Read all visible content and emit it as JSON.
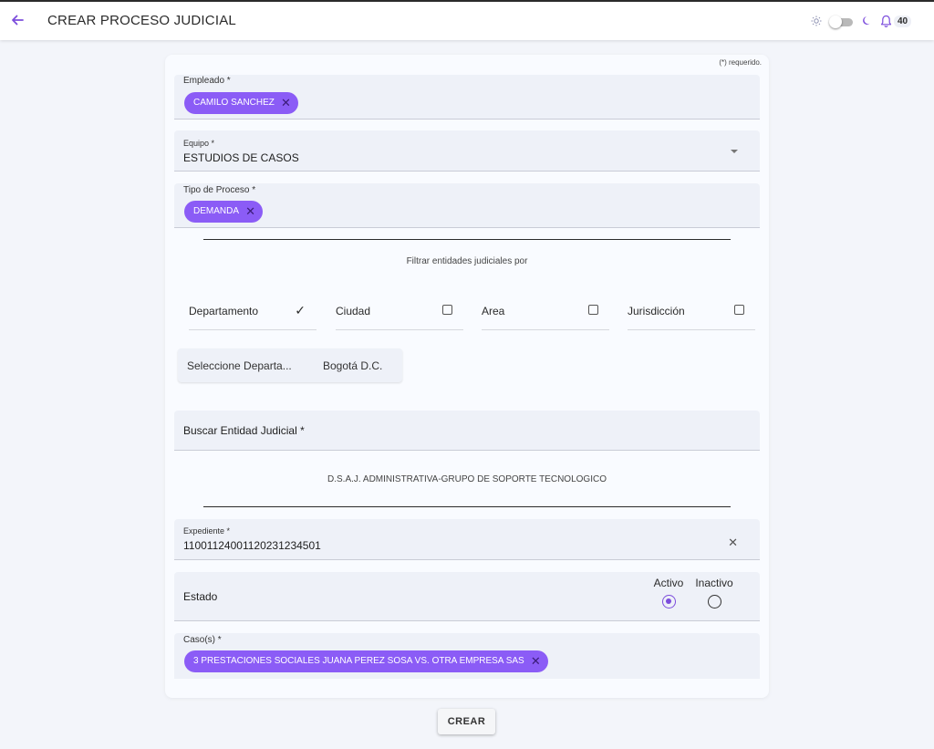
{
  "header": {
    "title": "CREAR PROCESO JUDICIAL",
    "notification_count": "40",
    "icons": {
      "back": "arrow-left",
      "light": "sun",
      "dark": "moon",
      "notifications": "bell"
    },
    "accent_color": "#8b5cf6"
  },
  "form": {
    "required_note": "(*) requerido.",
    "empleado": {
      "label": "Empleado *",
      "chip": "CAMILO SANCHEZ"
    },
    "equipo": {
      "label": "Equipo *",
      "value": "ESTUDIOS DE CASOS"
    },
    "tipo_proceso": {
      "label": "Tipo de Proceso *",
      "chip": "DEMANDA"
    },
    "filter_caption": "Filtrar entidades judiciales por",
    "filters": [
      {
        "label": "Departamento",
        "checked": true
      },
      {
        "label": "Ciudad",
        "checked": false
      },
      {
        "label": "Area",
        "checked": false
      },
      {
        "label": "Jurisdicción",
        "checked": false
      }
    ],
    "departamento_select": {
      "label": "Seleccione Departa...",
      "value": "Bogotá D.C."
    },
    "buscar_entidad": {
      "label": "Buscar Entidad Judicial *"
    },
    "entidad_seleccionada": "D.S.A.J. ADMINISTRATIVA-GRUPO DE SOPORTE TECNOLOGICO",
    "expediente": {
      "label": "Expediente *",
      "value": "11001124001120231234501"
    },
    "estado": {
      "label": "Estado",
      "options": [
        "Activo",
        "Inactivo"
      ],
      "selected": "Activo"
    },
    "casos": {
      "label": "Caso(s) *",
      "chip": "3 PRESTACIONES SOCIALES JUANA PEREZ SOSA VS. OTRA EMPRESA SAS"
    },
    "submit_label": "CREAR"
  }
}
